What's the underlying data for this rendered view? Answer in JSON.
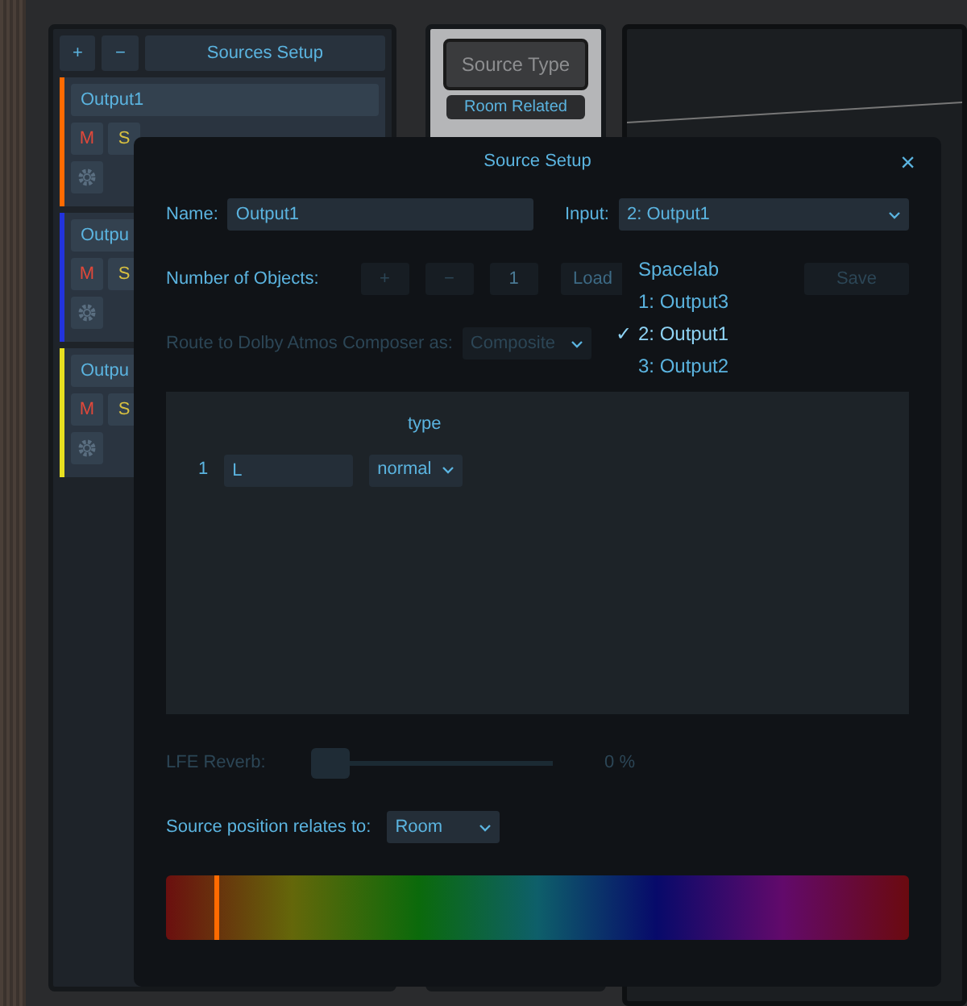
{
  "sources_panel": {
    "add_button": "+",
    "remove_button": "−",
    "title": "Sources Setup",
    "sources": [
      {
        "name": "Output1",
        "color": "#ff6a00",
        "mute": "M",
        "solo": "S"
      },
      {
        "name": "Outpu",
        "color": "#2233dd",
        "mute": "M",
        "solo": "S"
      },
      {
        "name": "Outpu",
        "color": "#e8e020",
        "mute": "M",
        "solo": "S"
      }
    ]
  },
  "source_type": {
    "button": "Source Type",
    "value": "Room Related"
  },
  "dialog": {
    "title": "Source Setup",
    "close": "×",
    "name_label": "Name:",
    "name_value": "Output1",
    "input_label": "Input:",
    "input_value": "2: Output1",
    "input_menu": {
      "header": "Spacelab",
      "check": "✓",
      "options": [
        {
          "label": "1: Output3",
          "selected": false
        },
        {
          "label": "2: Output1",
          "selected": true
        },
        {
          "label": "3: Output2",
          "selected": false
        }
      ]
    },
    "objects_label": "Number of Objects:",
    "objects_buttons": [
      {
        "label": "+",
        "disabled": true
      },
      {
        "label": "−",
        "disabled": true
      }
    ],
    "objects_count": "1",
    "load": "Load",
    "save": "Save",
    "route_label": "Route to Dolby Atmos Composer as:",
    "route_value": "Composite",
    "route_disabled": true,
    "objects_table": {
      "columns": [
        "type"
      ],
      "rows": [
        {
          "index": "1",
          "name": "L",
          "type": "normal"
        }
      ]
    },
    "lfe_label": "LFE Reverb:",
    "lfe_level": {
      "level": 0,
      "disabled": true
    },
    "lfe_reading": "0 %",
    "position_label": "Source position relates to:",
    "position_value": "Room",
    "color_bar": {
      "level": 0.065
    }
  }
}
